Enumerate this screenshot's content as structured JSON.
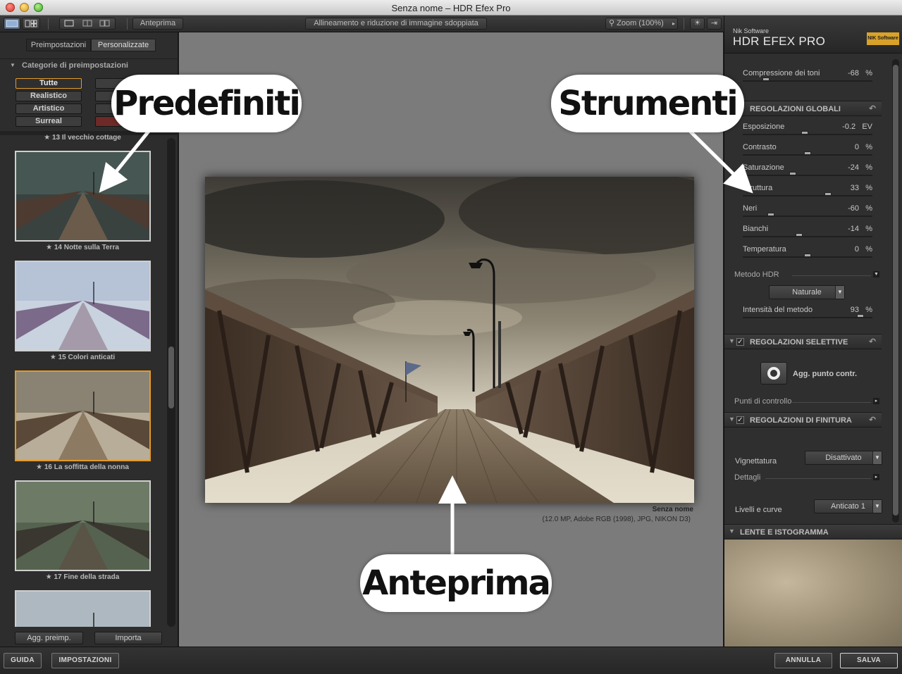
{
  "window": {
    "title": "Senza nome – HDR Efex Pro"
  },
  "toolbar": {
    "preview_label": "Anteprima",
    "align_label": "Allineamento e riduzione di immagine sdoppiata",
    "zoom_label": "Zoom (100%)"
  },
  "left_panel": {
    "tabs": [
      "Preimpostazioni",
      "Personalizzate"
    ],
    "categories_title": "Categorie di preimpostazioni",
    "category_buttons": [
      "Tutte",
      "Pa",
      "Realistico",
      "A",
      "Artistico",
      "",
      "Surreal",
      "P"
    ],
    "partial_label": "13 Il vecchio cottage",
    "presets": [
      {
        "label": "14 Notte sulla Terra"
      },
      {
        "label": "15 Colori anticati"
      },
      {
        "label": "16 La soffitta della nonna"
      },
      {
        "label": "17 Fine della strada"
      }
    ],
    "add_preset_label": "Agg. preimp.",
    "import_label": "Importa"
  },
  "center": {
    "image_title": "Senza nome",
    "image_meta": "(12.0 MP, Adobe RGB (1998), JPG, NIKON D3)"
  },
  "right_panel": {
    "brand_small": "Nik Software",
    "product": "HDR EFEX PRO",
    "badge": "NIK Software",
    "tone_compression": {
      "label": "Compressione dei toni",
      "value": "-68",
      "unit": "%",
      "level": -68
    },
    "global_title": "REGOLAZIONI GLOBALI",
    "global_sliders": [
      {
        "label": "Esposizione",
        "value": "-0.2",
        "unit": "EV",
        "level": -0.2,
        "min": -4,
        "max": 4
      },
      {
        "label": "Contrasto",
        "value": "0",
        "unit": "%",
        "level": 0,
        "min": -100,
        "max": 100
      },
      {
        "label": "Saturazione",
        "value": "-24",
        "unit": "%",
        "level": -24,
        "min": -100,
        "max": 100
      },
      {
        "label": "Struttura",
        "value": "33",
        "unit": "%",
        "level": 33,
        "min": -100,
        "max": 100
      },
      {
        "label": "Neri",
        "value": "-60",
        "unit": "%",
        "level": -60,
        "min": -100,
        "max": 100
      },
      {
        "label": "Bianchi",
        "value": "-14",
        "unit": "%",
        "level": -14,
        "min": -100,
        "max": 100
      },
      {
        "label": "Temperatura",
        "value": "0",
        "unit": "%",
        "level": 0,
        "min": -100,
        "max": 100
      }
    ],
    "hdr_method_label": "Metodo HDR",
    "hdr_method_value": "Naturale",
    "method_intensity": {
      "label": "Intensità del metodo",
      "value": "93",
      "unit": "%",
      "level": 93
    },
    "selective_title": "REGOLAZIONI SELETTIVE",
    "add_control_point": "Agg. punto contr.",
    "control_points_label": "Punti di controllo",
    "finishing_title": "REGOLAZIONI DI FINITURA",
    "vignette_label": "Vignettatura",
    "vignette_value": "Disattivato",
    "details_label": "Dettagli",
    "levels_label": "Livelli e curve",
    "levels_value": "Anticato 1",
    "lens_title": "LENTE E ISTOGRAMMA"
  },
  "bottom": {
    "guide": "GUIDA",
    "settings": "IMPOSTAZIONI",
    "cancel": "ANNULLA",
    "save": "SALVA"
  },
  "callouts": {
    "presets": "Predefiniti",
    "tools": "Strumenti",
    "preview": "Anteprima"
  }
}
